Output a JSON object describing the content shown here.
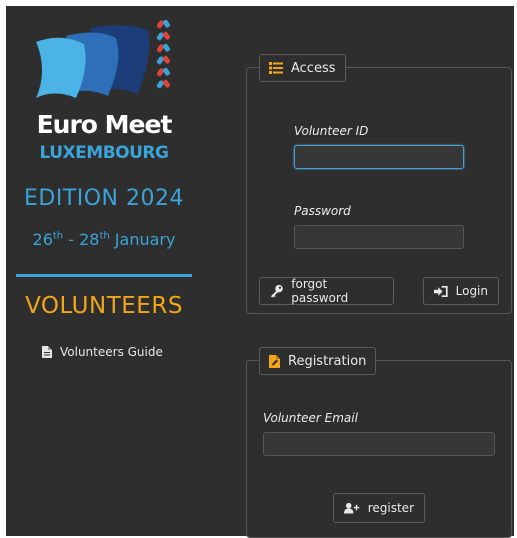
{
  "brand": {
    "name_line1": "Euro Meet",
    "name_line2": "LUXEMBOURG",
    "edition": "EDITION 2024",
    "dates": {
      "start_day": "26",
      "start_suffix": "th",
      "separator": " - ",
      "end_day": "28",
      "end_suffix": "th",
      "month": " January"
    },
    "section_title": "VOLUNTEERS",
    "colors": {
      "accent_blue": "#3aa3d8",
      "accent_orange": "#f2a516",
      "accent_red": "#e0433e"
    }
  },
  "sidebar": {
    "guide_link": {
      "label": "Volunteers Guide",
      "icon": "document-icon"
    }
  },
  "access": {
    "legend": "Access",
    "legend_icon": "list-icon",
    "volunteer_id_label": "Volunteer ID",
    "volunteer_id_value": "",
    "password_label": "Password",
    "password_value": "",
    "forgot_button": {
      "label": "forgot password",
      "icon": "key-icon"
    },
    "login_button": {
      "label": "Login",
      "icon": "sign-in-icon"
    }
  },
  "registration": {
    "legend": "Registration",
    "legend_icon": "edit-file-icon",
    "email_label": "Volunteer Email",
    "email_value": "",
    "register_button": {
      "label": "register",
      "icon": "user-plus-icon"
    }
  }
}
